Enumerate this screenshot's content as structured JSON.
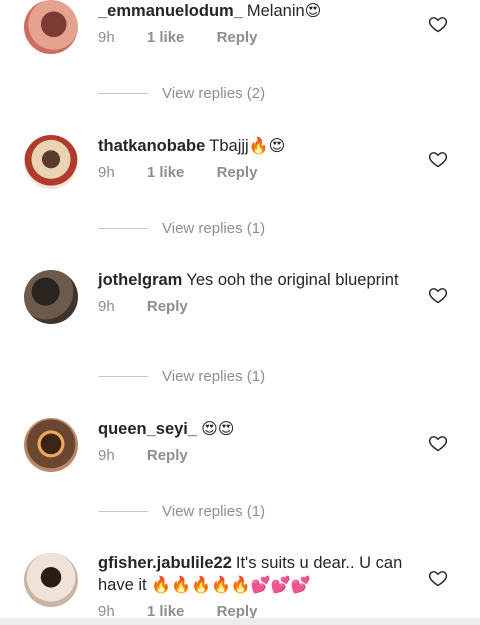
{
  "comments": [
    {
      "username": "_emmanuelodum_",
      "text": "Melanin",
      "emoji": "😍",
      "time": "9h",
      "likes": "1 like",
      "reply": "Reply",
      "view_replies": "View replies (2)",
      "avatar_color": "#d97f73"
    },
    {
      "username": "thatkanobabe",
      "text": "Tbajjj",
      "emoji": "🔥😍",
      "time": "9h",
      "likes": "1 like",
      "reply": "Reply",
      "view_replies": "View replies (1)",
      "avatar_color": "#c8a27d"
    },
    {
      "username": "jothelgram",
      "text": "Yes ooh the original blueprint",
      "emoji": "",
      "time": "9h",
      "likes": "",
      "reply": "Reply",
      "view_replies": "View replies (1)",
      "avatar_color": "#4b4038"
    },
    {
      "username": "queen_seyi_",
      "text": "",
      "emoji": "😍😍",
      "time": "9h",
      "likes": "",
      "reply": "Reply",
      "view_replies": "View replies (1)",
      "avatar_color": "#6b4630"
    },
    {
      "username": "gfisher.jabulile22",
      "text": "It's suits u dear.. U can have it",
      "emoji": "🔥🔥🔥🔥🔥💕💕💕",
      "time": "9h",
      "likes": "1 like",
      "reply": "Reply",
      "view_replies": "",
      "avatar_color": "#d9c8bb"
    }
  ],
  "colors": {
    "text": "#262626",
    "muted": "#8e8e8e",
    "divider": "#c7c7c7"
  },
  "icons": {
    "like": "heart-outline-icon"
  }
}
